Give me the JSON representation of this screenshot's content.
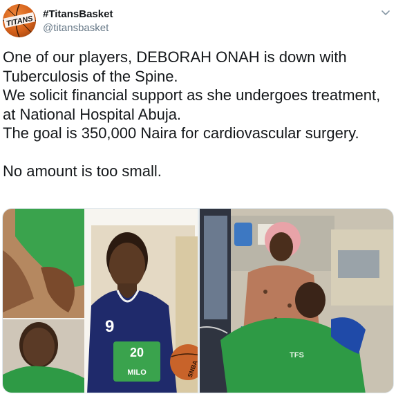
{
  "tweet": {
    "author": {
      "display_name": "#TitansBasket",
      "handle": "@titansbasket",
      "avatar_logo_text": "TITANS"
    },
    "body_lines": [
      "One of our players, DEBORAH ONAH is down with",
      "Tuberculosis of the Spine.",
      "We solicit financial support as she undergoes treatment,",
      "at National Hospital Abuja.",
      "The goal is 350,000 Naira for cardiovascular surgery.",
      "",
      "No amount is too small."
    ],
    "media": {
      "left_photo": {
        "jersey_number": "9",
        "jersey_badge": "20",
        "jersey_sponsor": "MILO",
        "ball_text": "SNBA"
      },
      "right_photo": {
        "shirt_text": "TFS"
      }
    }
  },
  "colors": {
    "text": "#14171a",
    "secondary": "#657786",
    "jersey_navy": "#1f2a6b",
    "green_shirt": "#2e9a45"
  },
  "icons": {
    "caret": "chevron-down-icon",
    "avatar": "basketball-logo-icon"
  }
}
